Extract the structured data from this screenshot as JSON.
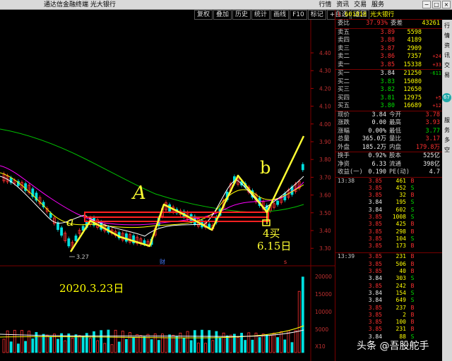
{
  "window": {
    "title": "通达信金融终端  光大银行",
    "menu": [
      "行情",
      "资讯",
      "交易",
      "服务"
    ],
    "controls": [
      "−",
      "□",
      "×"
    ]
  },
  "toolbar": [
    "复权",
    "叠加",
    "历史",
    "统计",
    "画线",
    "F10",
    "标记",
    "+自选",
    "返回"
  ],
  "stock": {
    "badge": "L",
    "code": "601818",
    "name": "光大银行"
  },
  "price_axis": [
    "4.40",
    "4.30",
    "4.20",
    "4.10",
    "4.00",
    "3.90",
    "3.80",
    "3.70",
    "3.60",
    "3.50",
    "3.40",
    "3.30"
  ],
  "volume_axis": [
    "20000",
    "15000",
    "10000",
    "5000",
    "X10"
  ],
  "low_label": "3.27",
  "markers": {
    "cai": "财",
    "s": "s"
  },
  "annotations": {
    "a": "a",
    "A": "A",
    "b": "b",
    "buy": "4买",
    "date": "6.15日",
    "start": "2020.3.23日"
  },
  "ratio": {
    "l1": "委比",
    "v1": "37.93%",
    "l2": "委差",
    "v2": "43261"
  },
  "asks": [
    {
      "label": "卖五",
      "price": "3.89",
      "vol": "5598",
      "chg": ""
    },
    {
      "label": "卖四",
      "price": "3.88",
      "vol": "4189",
      "chg": ""
    },
    {
      "label": "卖三",
      "price": "3.87",
      "vol": "2909",
      "chg": ""
    },
    {
      "label": "卖二",
      "price": "3.86",
      "vol": "7357",
      "chg": "+24"
    },
    {
      "label": "卖一",
      "price": "3.85",
      "vol": "15338",
      "chg": "+33"
    }
  ],
  "bids": [
    {
      "label": "买一",
      "price": "3.84",
      "vol": "21250",
      "chg": "-611"
    },
    {
      "label": "买二",
      "price": "3.83",
      "vol": "15080",
      "chg": ""
    },
    {
      "label": "买三",
      "price": "3.82",
      "vol": "12650",
      "chg": ""
    },
    {
      "label": "买四",
      "price": "3.81",
      "vol": "12975",
      "chg": "+5"
    },
    {
      "label": "买五",
      "price": "3.80",
      "vol": "16689",
      "chg": "+12"
    }
  ],
  "stats1": [
    {
      "l1": "现价",
      "v1": "3.84",
      "l2": "今开",
      "v2": "3.78"
    },
    {
      "l1": "涨跌",
      "v1": "0.00",
      "l2": "最高",
      "v2": "3.93"
    },
    {
      "l1": "涨幅",
      "v1": "0.00%",
      "l2": "最低",
      "v2": "3.77"
    },
    {
      "l1": "总量",
      "v1": "365.0万",
      "l2": "量比",
      "v2": "3.17"
    },
    {
      "l1": "外盘",
      "v1": "185.2万",
      "l2": "内盘",
      "v2": "179.8万"
    }
  ],
  "stats2": [
    {
      "l1": "换手",
      "v1": "0.92%",
      "l2": "股本",
      "v2": "525亿"
    },
    {
      "l1": "净资",
      "v1": "6.33",
      "l2": "流通",
      "v2": "398亿"
    },
    {
      "l1": "收益(一)",
      "v1": "0.190",
      "l2": "PE(动)",
      "v2": "4.7"
    }
  ],
  "ticks1": [
    {
      "t": "13:38",
      "p": "3.85",
      "v": "461",
      "bs": "B"
    },
    {
      "t": "",
      "p": "3.85",
      "v": "452",
      "bs": "S"
    },
    {
      "t": "",
      "p": "3.85",
      "v": "32",
      "bs": "B"
    },
    {
      "t": "",
      "p": "3.84",
      "v": "195",
      "bs": "S"
    },
    {
      "t": "",
      "p": "3.84",
      "v": "602",
      "bs": "S"
    },
    {
      "t": "",
      "p": "3.85",
      "v": "1008",
      "bs": "S"
    },
    {
      "t": "",
      "p": "3.85",
      "v": "425",
      "bs": "B"
    },
    {
      "t": "",
      "p": "3.85",
      "v": "298",
      "bs": "B"
    },
    {
      "t": "",
      "p": "3.85",
      "v": "104",
      "bs": "S"
    },
    {
      "t": "",
      "p": "3.85",
      "v": "173",
      "bs": "B"
    }
  ],
  "ticks2": [
    {
      "t": "13:39",
      "p": "3.85",
      "v": "231",
      "bs": "B"
    },
    {
      "t": "",
      "p": "3.85",
      "v": "506",
      "bs": "B"
    },
    {
      "t": "",
      "p": "3.85",
      "v": "40",
      "bs": "B"
    },
    {
      "t": "",
      "p": "3.84",
      "v": "303",
      "bs": "S"
    },
    {
      "t": "",
      "p": "3.85",
      "v": "242",
      "bs": "B"
    },
    {
      "t": "",
      "p": "3.84",
      "v": "154",
      "bs": "S"
    },
    {
      "t": "",
      "p": "3.84",
      "v": "649",
      "bs": "S"
    },
    {
      "t": "",
      "p": "3.85",
      "v": "237",
      "bs": "B"
    },
    {
      "t": "",
      "p": "3.85",
      "v": "2",
      "bs": "B"
    },
    {
      "t": "",
      "p": "3.85",
      "v": "100",
      "bs": "B"
    },
    {
      "t": "",
      "p": "3.85",
      "v": "231",
      "bs": "B"
    },
    {
      "t": "",
      "p": "3.84",
      "v": "88",
      "bs": "S"
    }
  ],
  "sidebar": [
    "行",
    "情",
    "资",
    "讯",
    "交",
    "易",
    "服",
    "务",
    "多",
    "空"
  ],
  "sidebar_badge": "67",
  "watermark": "头条 @吾股舵手",
  "colors": {
    "up": "#ff3030",
    "down": "#00e000",
    "ma5": "#ffffff",
    "ma10": "#ffff00",
    "ma20": "#ff00ff",
    "ma60": "#00c000",
    "annotation": "#ffff33",
    "box": "#ff2020"
  }
}
